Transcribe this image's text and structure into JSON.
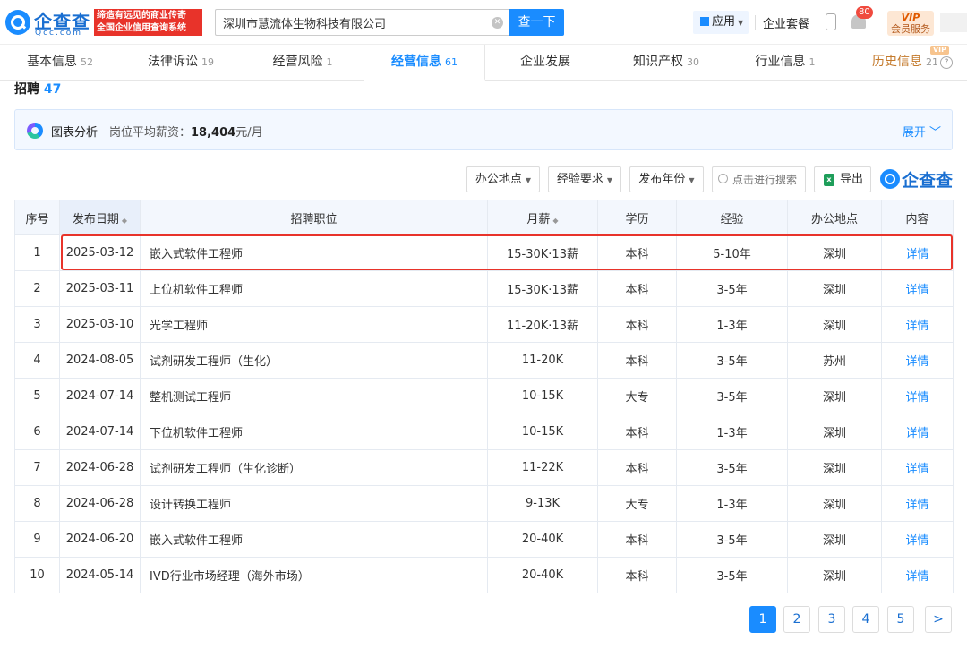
{
  "header": {
    "logo_text": "企查查",
    "logo_sub": "Qcc.com",
    "slogan_line1": "缔造有远见的商业传奇",
    "slogan_line2": "全国企业信用查询系统",
    "search_value": "深圳市慧流体生物科技有限公司",
    "search_button": "查一下",
    "app_menu": "应用",
    "suite": "企业套餐",
    "bell_badge": "80",
    "vip_line1": "VIP",
    "vip_line2": "会员服务"
  },
  "tabs": [
    {
      "label": "基本信息",
      "count": "52"
    },
    {
      "label": "法律诉讼",
      "count": "19"
    },
    {
      "label": "经营风险",
      "count": "1"
    },
    {
      "label": "经营信息",
      "count": "61"
    },
    {
      "label": "企业发展",
      "count": ""
    },
    {
      "label": "知识产权",
      "count": "30"
    },
    {
      "label": "行业信息",
      "count": "1"
    },
    {
      "label": "历史信息",
      "count": "21",
      "tag": "VIP"
    }
  ],
  "section": {
    "title": "招聘",
    "count": "47"
  },
  "analysis": {
    "label": "图表分析",
    "salary_prefix": "岗位平均薪资：",
    "salary_value": "18,404",
    "salary_unit": "元/月",
    "expand": "展开"
  },
  "filters": {
    "location": "办公地点",
    "experience": "经验要求",
    "year": "发布年份",
    "search_placeholder": "点击进行搜索",
    "export": "导出",
    "brand": "企查查"
  },
  "table": {
    "headers": [
      "序号",
      "发布日期",
      "招聘职位",
      "月薪",
      "学历",
      "经验",
      "办公地点",
      "内容"
    ],
    "rows": [
      [
        "1",
        "2025-03-12",
        "嵌入式软件工程师",
        "15-30K·13薪",
        "本科",
        "5-10年",
        "深圳",
        "详情"
      ],
      [
        "2",
        "2025-03-11",
        "上位机软件工程师",
        "15-30K·13薪",
        "本科",
        "3-5年",
        "深圳",
        "详情"
      ],
      [
        "3",
        "2025-03-10",
        "光学工程师",
        "11-20K·13薪",
        "本科",
        "1-3年",
        "深圳",
        "详情"
      ],
      [
        "4",
        "2024-08-05",
        "试剂研发工程师（生化）",
        "11-20K",
        "本科",
        "3-5年",
        "苏州",
        "详情"
      ],
      [
        "5",
        "2024-07-14",
        "整机测试工程师",
        "10-15K",
        "大专",
        "3-5年",
        "深圳",
        "详情"
      ],
      [
        "6",
        "2024-07-14",
        "下位机软件工程师",
        "10-15K",
        "本科",
        "1-3年",
        "深圳",
        "详情"
      ],
      [
        "7",
        "2024-06-28",
        "试剂研发工程师（生化诊断）",
        "11-22K",
        "本科",
        "3-5年",
        "深圳",
        "详情"
      ],
      [
        "8",
        "2024-06-28",
        "设计转换工程师",
        "9-13K",
        "大专",
        "1-3年",
        "深圳",
        "详情"
      ],
      [
        "9",
        "2024-06-20",
        "嵌入式软件工程师",
        "20-40K",
        "本科",
        "3-5年",
        "深圳",
        "详情"
      ],
      [
        "10",
        "2024-05-14",
        "IVD行业市场经理（海外市场）",
        "20-40K",
        "本科",
        "3-5年",
        "深圳",
        "详情"
      ]
    ]
  },
  "pagination": {
    "pages": [
      "1",
      "2",
      "3",
      "4",
      "5"
    ],
    "next": ">",
    "current": "1"
  },
  "colors": {
    "accent": "#1a8cff",
    "highlight": "#e8332a"
  }
}
